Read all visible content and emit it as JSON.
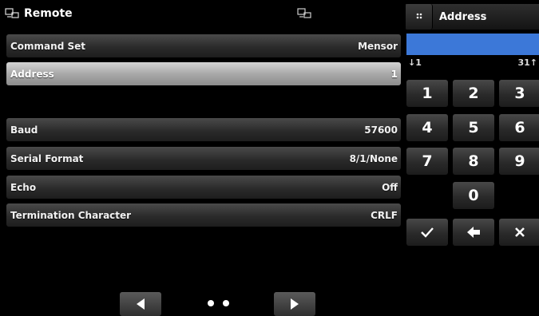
{
  "header": {
    "title": "Remote",
    "remote_icon": "remote-display-icon"
  },
  "rows": [
    {
      "label": "Command Set",
      "value": "Mensor"
    },
    {
      "label": "Address",
      "value": "1"
    },
    {
      "label": "Baud",
      "value": "57600"
    },
    {
      "label": "Serial Format",
      "value": "8/1/None"
    },
    {
      "label": "Echo",
      "value": "Off"
    },
    {
      "label": "Termination Character",
      "value": "CRLF"
    }
  ],
  "keypad": {
    "title": "Address",
    "input_value": "",
    "min": "↓1",
    "max": "31↑",
    "keys": [
      "1",
      "2",
      "3",
      "4",
      "5",
      "6",
      "7",
      "8",
      "9",
      "0"
    ],
    "accent_color": "#3c78d8"
  },
  "pagination": {
    "page": 1,
    "total": 2
  }
}
